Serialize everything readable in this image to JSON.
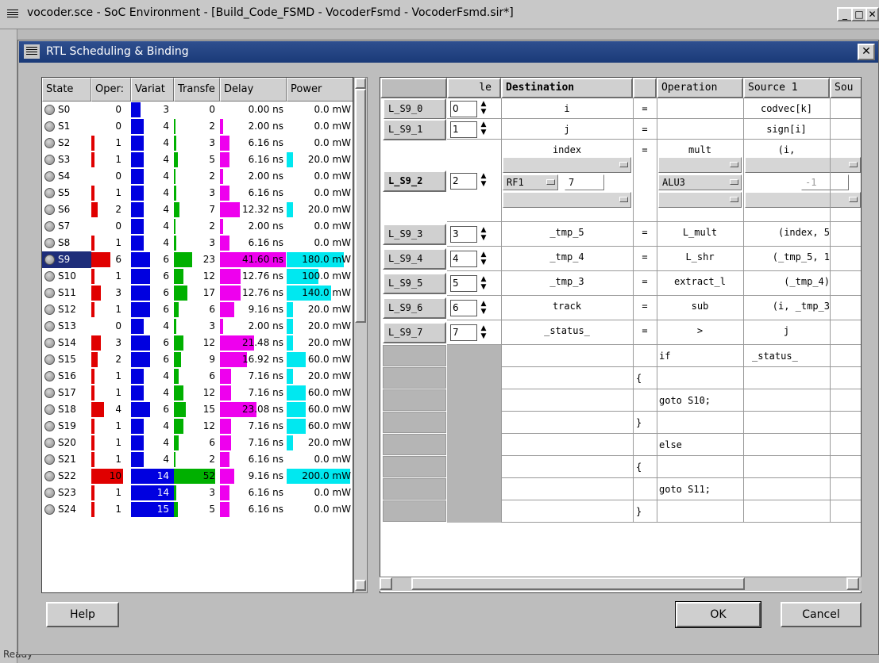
{
  "outer_window": {
    "title": "vocoder.sce - SoC Environment - [Build_Code_FSMD - VocoderFsmd - VocoderFsmd.sir*]",
    "status": "Ready",
    "min": "_",
    "max": "□",
    "close": "✕"
  },
  "dialog": {
    "title": "RTL Scheduling & Binding",
    "close": "✕"
  },
  "left_table": {
    "columns": [
      "State",
      "Oper:",
      "Variat",
      "Transfe",
      "Delay",
      "Power"
    ],
    "rows": [
      {
        "state": "S0",
        "ops": "0",
        "vars": "3",
        "trans": "0",
        "delay": "0.00 ns",
        "power": "0.0 mW"
      },
      {
        "state": "S1",
        "ops": "0",
        "vars": "4",
        "trans": "2",
        "delay": "2.00 ns",
        "power": "0.0 mW"
      },
      {
        "state": "S2",
        "ops": "1",
        "vars": "4",
        "trans": "3",
        "delay": "6.16 ns",
        "power": "0.0 mW"
      },
      {
        "state": "S3",
        "ops": "1",
        "vars": "4",
        "trans": "5",
        "delay": "6.16 ns",
        "power": "20.0 mW"
      },
      {
        "state": "S4",
        "ops": "0",
        "vars": "4",
        "trans": "2",
        "delay": "2.00 ns",
        "power": "0.0 mW"
      },
      {
        "state": "S5",
        "ops": "1",
        "vars": "4",
        "trans": "3",
        "delay": "6.16 ns",
        "power": "0.0 mW"
      },
      {
        "state": "S6",
        "ops": "2",
        "vars": "4",
        "trans": "7",
        "delay": "12.32 ns",
        "power": "20.0 mW"
      },
      {
        "state": "S7",
        "ops": "0",
        "vars": "4",
        "trans": "2",
        "delay": "2.00 ns",
        "power": "0.0 mW"
      },
      {
        "state": "S8",
        "ops": "1",
        "vars": "4",
        "trans": "3",
        "delay": "6.16 ns",
        "power": "0.0 mW"
      },
      {
        "state": "S9",
        "ops": "6",
        "vars": "6",
        "trans": "23",
        "delay": "41.60 ns",
        "power": "180.0 mW"
      },
      {
        "state": "S10",
        "ops": "1",
        "vars": "6",
        "trans": "12",
        "delay": "12.76 ns",
        "power": "100.0 mW"
      },
      {
        "state": "S11",
        "ops": "3",
        "vars": "6",
        "trans": "17",
        "delay": "12.76 ns",
        "power": "140.0 mW"
      },
      {
        "state": "S12",
        "ops": "1",
        "vars": "6",
        "trans": "6",
        "delay": "9.16 ns",
        "power": "20.0 mW"
      },
      {
        "state": "S13",
        "ops": "0",
        "vars": "4",
        "trans": "3",
        "delay": "2.00 ns",
        "power": "20.0 mW"
      },
      {
        "state": "S14",
        "ops": "3",
        "vars": "6",
        "trans": "12",
        "delay": "21.48 ns",
        "power": "20.0 mW"
      },
      {
        "state": "S15",
        "ops": "2",
        "vars": "6",
        "trans": "9",
        "delay": "16.92 ns",
        "power": "60.0 mW"
      },
      {
        "state": "S16",
        "ops": "1",
        "vars": "4",
        "trans": "6",
        "delay": "7.16 ns",
        "power": "20.0 mW"
      },
      {
        "state": "S17",
        "ops": "1",
        "vars": "4",
        "trans": "12",
        "delay": "7.16 ns",
        "power": "60.0 mW"
      },
      {
        "state": "S18",
        "ops": "4",
        "vars": "6",
        "trans": "15",
        "delay": "23.08 ns",
        "power": "60.0 mW"
      },
      {
        "state": "S19",
        "ops": "1",
        "vars": "4",
        "trans": "12",
        "delay": "7.16 ns",
        "power": "60.0 mW"
      },
      {
        "state": "S20",
        "ops": "1",
        "vars": "4",
        "trans": "6",
        "delay": "7.16 ns",
        "power": "20.0 mW"
      },
      {
        "state": "S21",
        "ops": "1",
        "vars": "4",
        "trans": "2",
        "delay": "6.16 ns",
        "power": "0.0 mW"
      },
      {
        "state": "S22",
        "ops": "10",
        "vars": "14",
        "trans": "52",
        "delay": "9.16 ns",
        "power": "200.0 mW"
      },
      {
        "state": "S23",
        "ops": "1",
        "vars": "14",
        "trans": "3",
        "delay": "6.16 ns",
        "power": "0.0 mW"
      },
      {
        "state": "S24",
        "ops": "1",
        "vars": "15",
        "trans": "5",
        "delay": "6.16 ns",
        "power": "0.0 mW"
      }
    ],
    "selected": "S9"
  },
  "right_table": {
    "columns": [
      "le",
      "Destination",
      "",
      "Operation",
      "Source 1",
      "Sou"
    ],
    "rows": [
      {
        "label": "L_S9_0",
        "cycle": "0",
        "dest": "i",
        "eq": "=",
        "op": "",
        "src1": "codvec[k]"
      },
      {
        "label": "L_S9_1",
        "cycle": "1",
        "dest": "j",
        "eq": "=",
        "op": "",
        "src1": "sign[i]"
      },
      {
        "label": "L_S9_2",
        "cycle": "2",
        "dest": "index",
        "eq": "=",
        "op": "mult",
        "src1": "(i,"
      },
      {
        "label": "L_S9_3",
        "cycle": "3",
        "dest": "_tmp_5",
        "eq": "=",
        "op": "L_mult",
        "src1": "(index, 5"
      },
      {
        "label": "L_S9_4",
        "cycle": "4",
        "dest": "_tmp_4",
        "eq": "=",
        "op": "L_shr",
        "src1": "(_tmp_5, 1"
      },
      {
        "label": "L_S9_5",
        "cycle": "5",
        "dest": "_tmp_3",
        "eq": "=",
        "op": "extract_l",
        "src1": "(_tmp_4)"
      },
      {
        "label": "L_S9_6",
        "cycle": "6",
        "dest": "track",
        "eq": "=",
        "op": "sub",
        "src1": "(i, _tmp_3"
      },
      {
        "label": "L_S9_7",
        "cycle": "7",
        "dest": "_status_",
        "eq": "=",
        "op": ">",
        "src1": "j"
      }
    ],
    "binding": {
      "rf": "RF1",
      "rf_index": "7",
      "alu": "ALU3",
      "alu_index": "-1"
    },
    "code": [
      {
        "c2": "",
        "c3": "if",
        "c4": "_status_"
      },
      {
        "c2": "{",
        "c3": "",
        "c4": ""
      },
      {
        "c2": "",
        "c3": "goto S10;",
        "c4": ""
      },
      {
        "c2": "}",
        "c3": "",
        "c4": ""
      },
      {
        "c2": "",
        "c3": "else",
        "c4": ""
      },
      {
        "c2": "{",
        "c3": "",
        "c4": ""
      },
      {
        "c2": "",
        "c3": "goto S11;",
        "c4": ""
      },
      {
        "c2": "}",
        "c3": "",
        "c4": ""
      }
    ]
  },
  "buttons": {
    "help": "Help",
    "ok": "OK",
    "cancel": "Cancel"
  }
}
